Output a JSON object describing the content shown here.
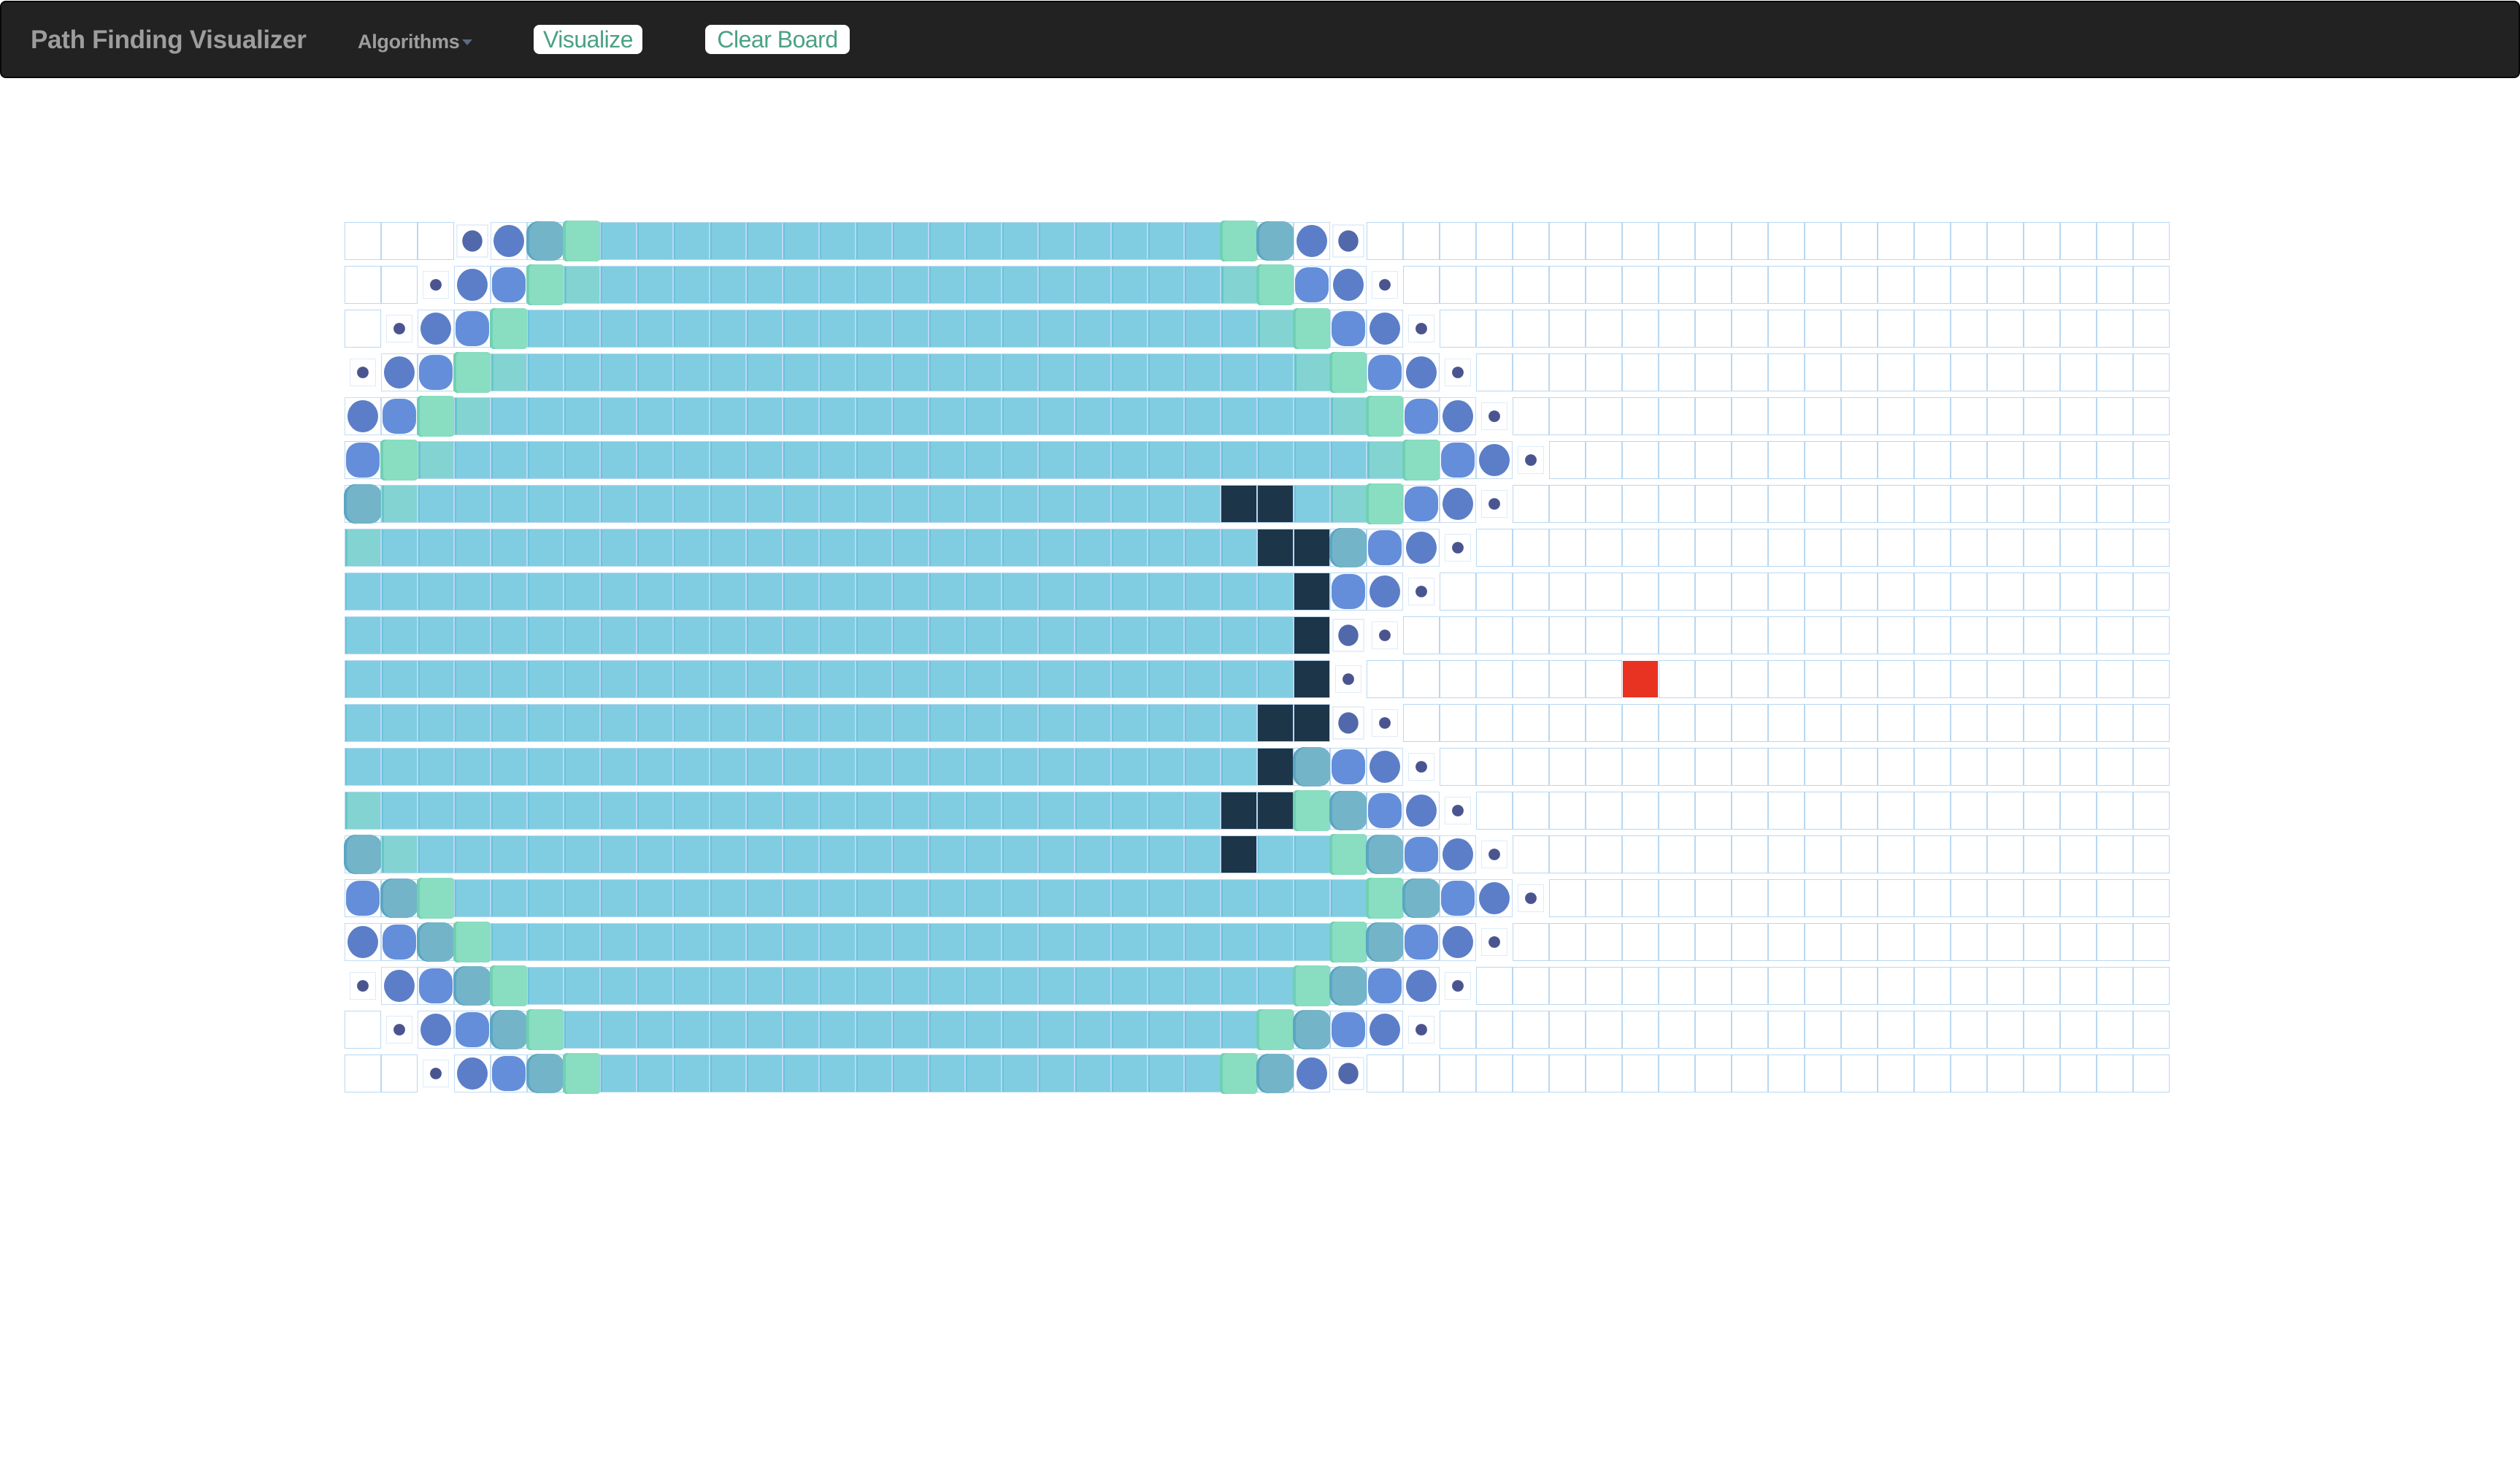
{
  "navbar": {
    "brand": "Path Finding Visualizer",
    "algorithms_menu": {
      "label": "Algorithms",
      "icon": "caret-down-icon"
    },
    "buttons": {
      "visualize": "Visualize",
      "clear_board": "Clear Board"
    }
  },
  "colors": {
    "navbar_bg": "#222222",
    "navbar_text": "#9d9d9d",
    "button_text": "#4aa183",
    "cell_border": "#b8d8f2",
    "visited": "#80cde1",
    "visited_fresh": "#83d3d3",
    "visiting_green": "#89ddc0",
    "visiting_teal": "#74b4c9",
    "visiting_blue": "#648ed9",
    "frontier_circle": "#5c7ec8",
    "frontier_medium": "#5169ab",
    "frontier_dot": "#4a5590",
    "wall": "#1c3549",
    "target": "#e83323"
  },
  "grid": {
    "rows": 20,
    "cols": 50,
    "legend": {
      ".": "unvisited",
      "V": "visited",
      "T": "visited-fresh",
      "G": "visiting-green",
      "S": "visiting-teal",
      "R": "visiting-blue",
      "C": "frontier-circle",
      "M": "frontier-medium",
      "D": "frontier-dot",
      "W": "wall",
      "E": "target"
    },
    "cells": [
      "...MCSGVVVVVVVVVVVVVVVVVGSCM......................",
      "..DCRGTVVVVVVVVVVVVVVVVVTGRCD.....................",
      ".DCRGVVVVVVVVVVVVVVVVVVVVTGRCD....................",
      "DCRGTVVVVVVVVVVVVVVVVVVVVVTGRCD...................",
      "CRGTVVVVVVVVVVVVVVVVVVVVVVVTGRCD..................",
      "RGTVVVVVVVVVVVVVVVVVVVVVVVVVTGRCD.................",
      "STVVVVVVVVVVVVVVVVVVVVVVWWVTGRCD..................",
      "TVVVVVVVVVVVVVVVVVVVVVVVVWWSRCD...................",
      "VVVVVVVVVVVVVVVVVVVVVVVVVVWRCD....................",
      "VVVVVVVVVVVVVVVVVVVVVVVVVVWMD.....................",
      "VVVVVVVVVVVVVVVVVVVVVVVVVVWD.......E..............",
      "VVVVVVVVVVVVVVVVVVVVVVVVVWWMD.....................",
      "VVVVVVVVVVVVVVVVVVVVVVVVVWSRCD....................",
      "TVVVVVVVVVVVVVVVVVVVVVVVWWGSRCD...................",
      "STVVVVVVVVVVVVVVVVVVVVVVWVVGSRCD..................",
      "RSGVVVVVVVVVVVVVVVVVVVVVVVVVGSRCD.................",
      "CRSGVVVVVVVVVVVVVVVVVVVVVVVGSRCD..................",
      "DCRSGVVVVVVVVVVVVVVVVVVVVVGSRCD...................",
      ".DCRSGVVVVVVVVVVVVVVVVVVVGSRCD....................",
      "..DCRSGVVVVVVVVVVVVVVVVVGSCM......................"
    ]
  }
}
